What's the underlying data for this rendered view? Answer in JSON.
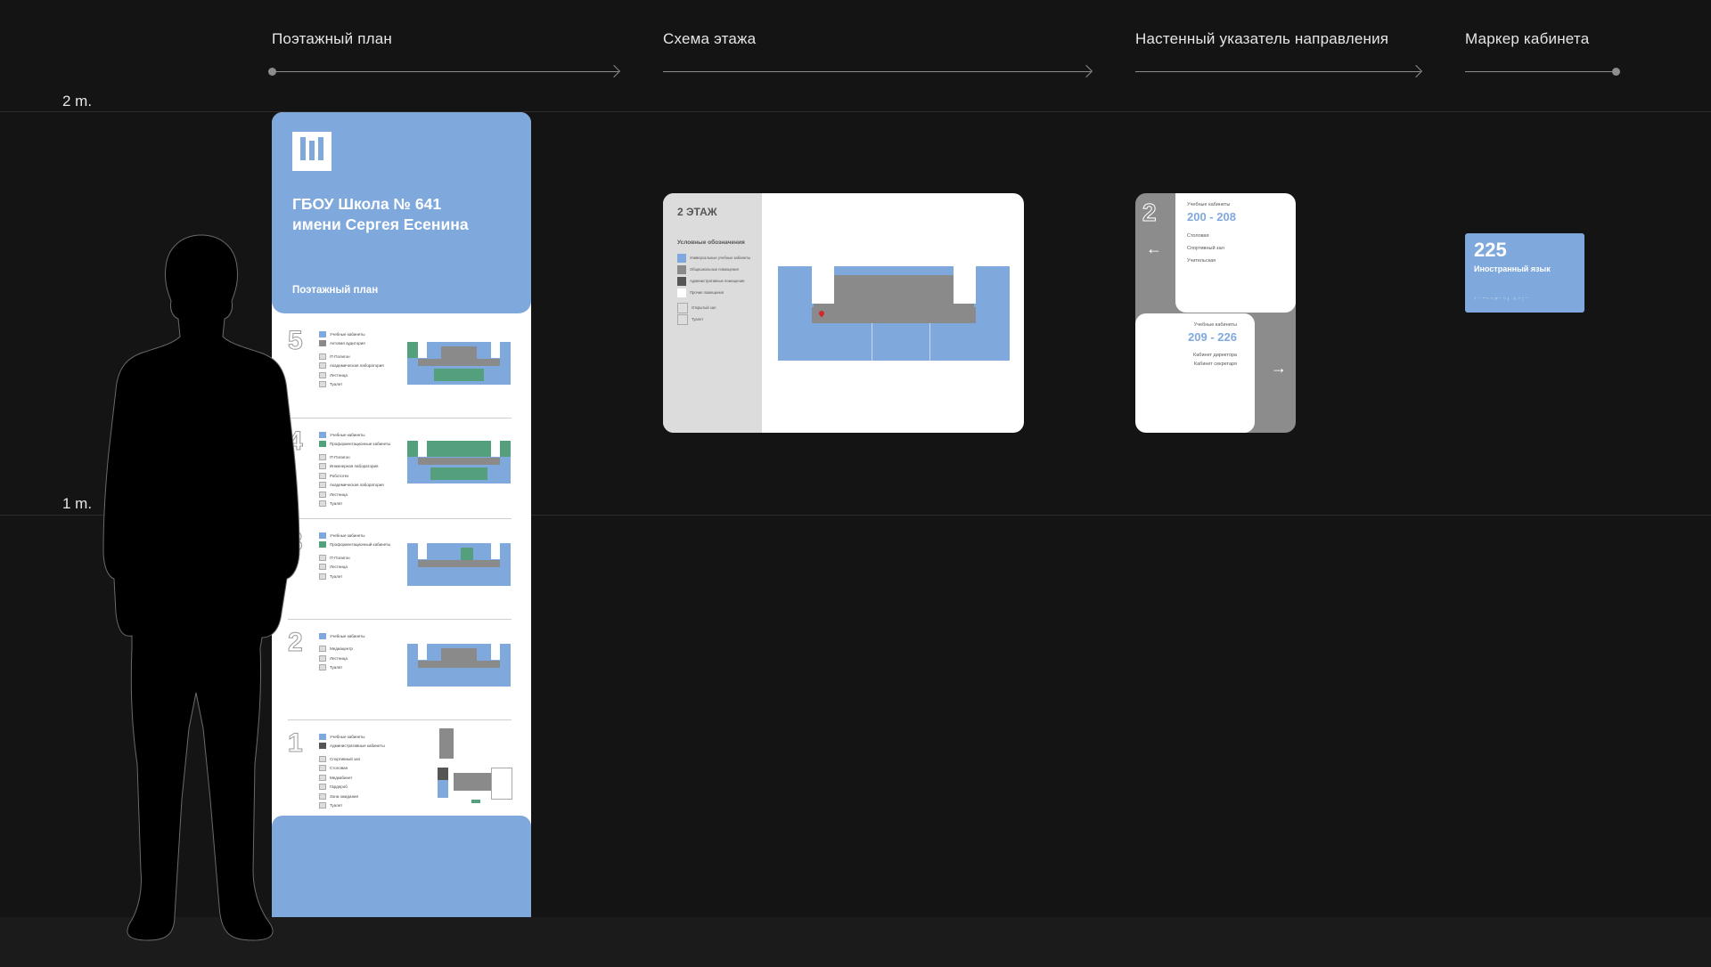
{
  "sections": [
    {
      "label": "Поэтажный план"
    },
    {
      "label": "Схема этажа"
    },
    {
      "label": "Настенный указатель направления"
    },
    {
      "label": "Маркер кабинета"
    }
  ],
  "scale": {
    "top": "2 m.",
    "mid": "1 m."
  },
  "stand": {
    "title_line1": "ГБОУ Школа № 641",
    "title_line2": "имени Сергея Есенина",
    "subtitle": "Поэтажный план",
    "floors": [
      {
        "num": "5",
        "legend": [
          "Учебные кабинеты",
          "Актовая аудитория",
          "IT-Полигон",
          "Академическая лаборатория",
          "Лестница",
          "Туалет"
        ]
      },
      {
        "num": "4",
        "legend": [
          "Учебные кабинеты",
          "Профориентационные кабинеты",
          "IT-Полигон",
          "Инженерная лаборатория",
          "Робототех",
          "Академическая лаборатория",
          "Лестница",
          "Туалет"
        ]
      },
      {
        "num": "3",
        "legend": [
          "Учебные кабинеты",
          "Профориентационный кабинеты",
          "IT-Полигон",
          "Лестница",
          "Туалет"
        ]
      },
      {
        "num": "2",
        "legend": [
          "Учебные кабинеты",
          "Медиацентр",
          "Лестница",
          "Туалет"
        ]
      },
      {
        "num": "1",
        "legend": [
          "Учебные кабинеты",
          "Административные кабинеты",
          "Спортивный зал",
          "Столовая",
          "Медкабинет",
          "Гардероб",
          "Зона ожидания",
          "Туалет"
        ]
      }
    ]
  },
  "scheme": {
    "title": "2 ЭТАЖ",
    "legend_title": "Условные обозначения",
    "legend": [
      "Универсальные учебные кабинеты",
      "Общешкольные помещения",
      "Административные помещения",
      "Прочие помещения",
      "Открытый зал",
      "Туалет"
    ]
  },
  "direction": {
    "floor": "2",
    "top": {
      "label": "Учебные кабинеты",
      "range": "200 - 208",
      "items": [
        "Столовая",
        "Спортивный зал",
        "Учительская"
      ]
    },
    "bottom": {
      "label": "Учебные кабинеты",
      "range": "209 - 226",
      "items": [
        "Кабинет директора",
        "Кабинет секретаря"
      ]
    },
    "arrow_left": "←",
    "arrow_right": "→"
  },
  "marker": {
    "number": "225",
    "name": "Иностранный язык",
    "braille": "⠃⠁⠉⠃⠑⠛⠁⠑⠇ ⠓⠊⠅⠁"
  },
  "colors": {
    "accent": "#7fa9dc",
    "green": "#55a07c",
    "grey": "#8a8a8a",
    "background": "#141414"
  }
}
